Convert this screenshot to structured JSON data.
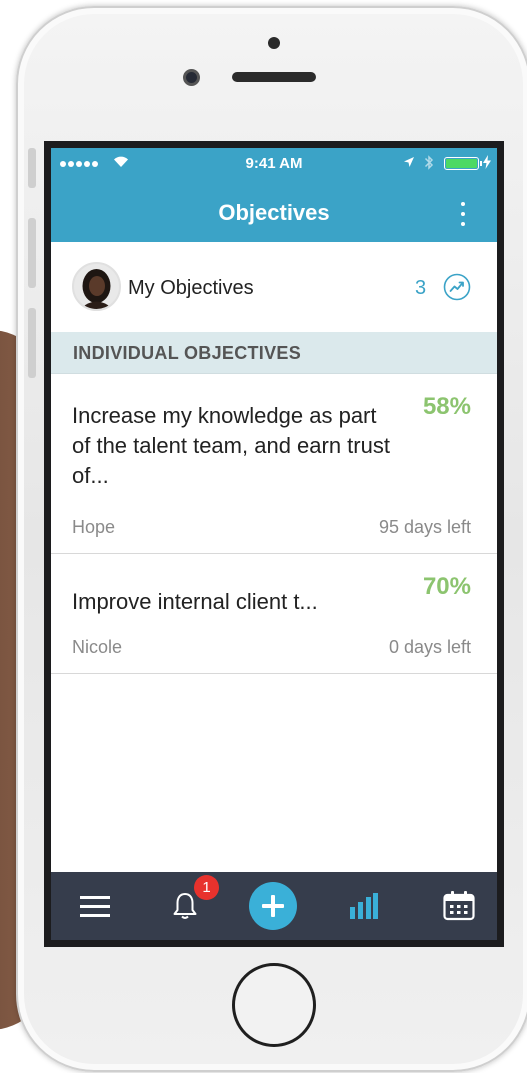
{
  "status_bar": {
    "time": "9:41 AM"
  },
  "header": {
    "title": "Objectives"
  },
  "my_objectives": {
    "label": "My Objectives",
    "count": "3"
  },
  "section": {
    "title": "INDIVIDUAL OBJECTIVES"
  },
  "objectives": [
    {
      "title": "Increase my knowledge as part of the talent team, and earn trust of...",
      "percent": "58%",
      "progress": 0.58,
      "owner": "Hope",
      "days_left": "95 days left"
    },
    {
      "title": "Improve internal client t...",
      "percent": "70%",
      "progress": 0.7,
      "owner": "Nicole",
      "days_left": "0 days left"
    }
  ],
  "tabbar": {
    "notification_badge": "1"
  },
  "colors": {
    "header": "#3ba3c7",
    "accent": "#3ab0d8",
    "progress_text": "#8cc46f",
    "section_bg": "#dbe9ec",
    "tabbar": "#363d4c",
    "badge": "#e8322d"
  },
  "icons": {
    "header_more": "more-vertical-icon",
    "trend": "trend-icon",
    "menu": "menu-icon",
    "notifications": "bell-icon",
    "add": "plus-icon",
    "stats": "bar-chart-icon",
    "calendar": "calendar-icon"
  }
}
